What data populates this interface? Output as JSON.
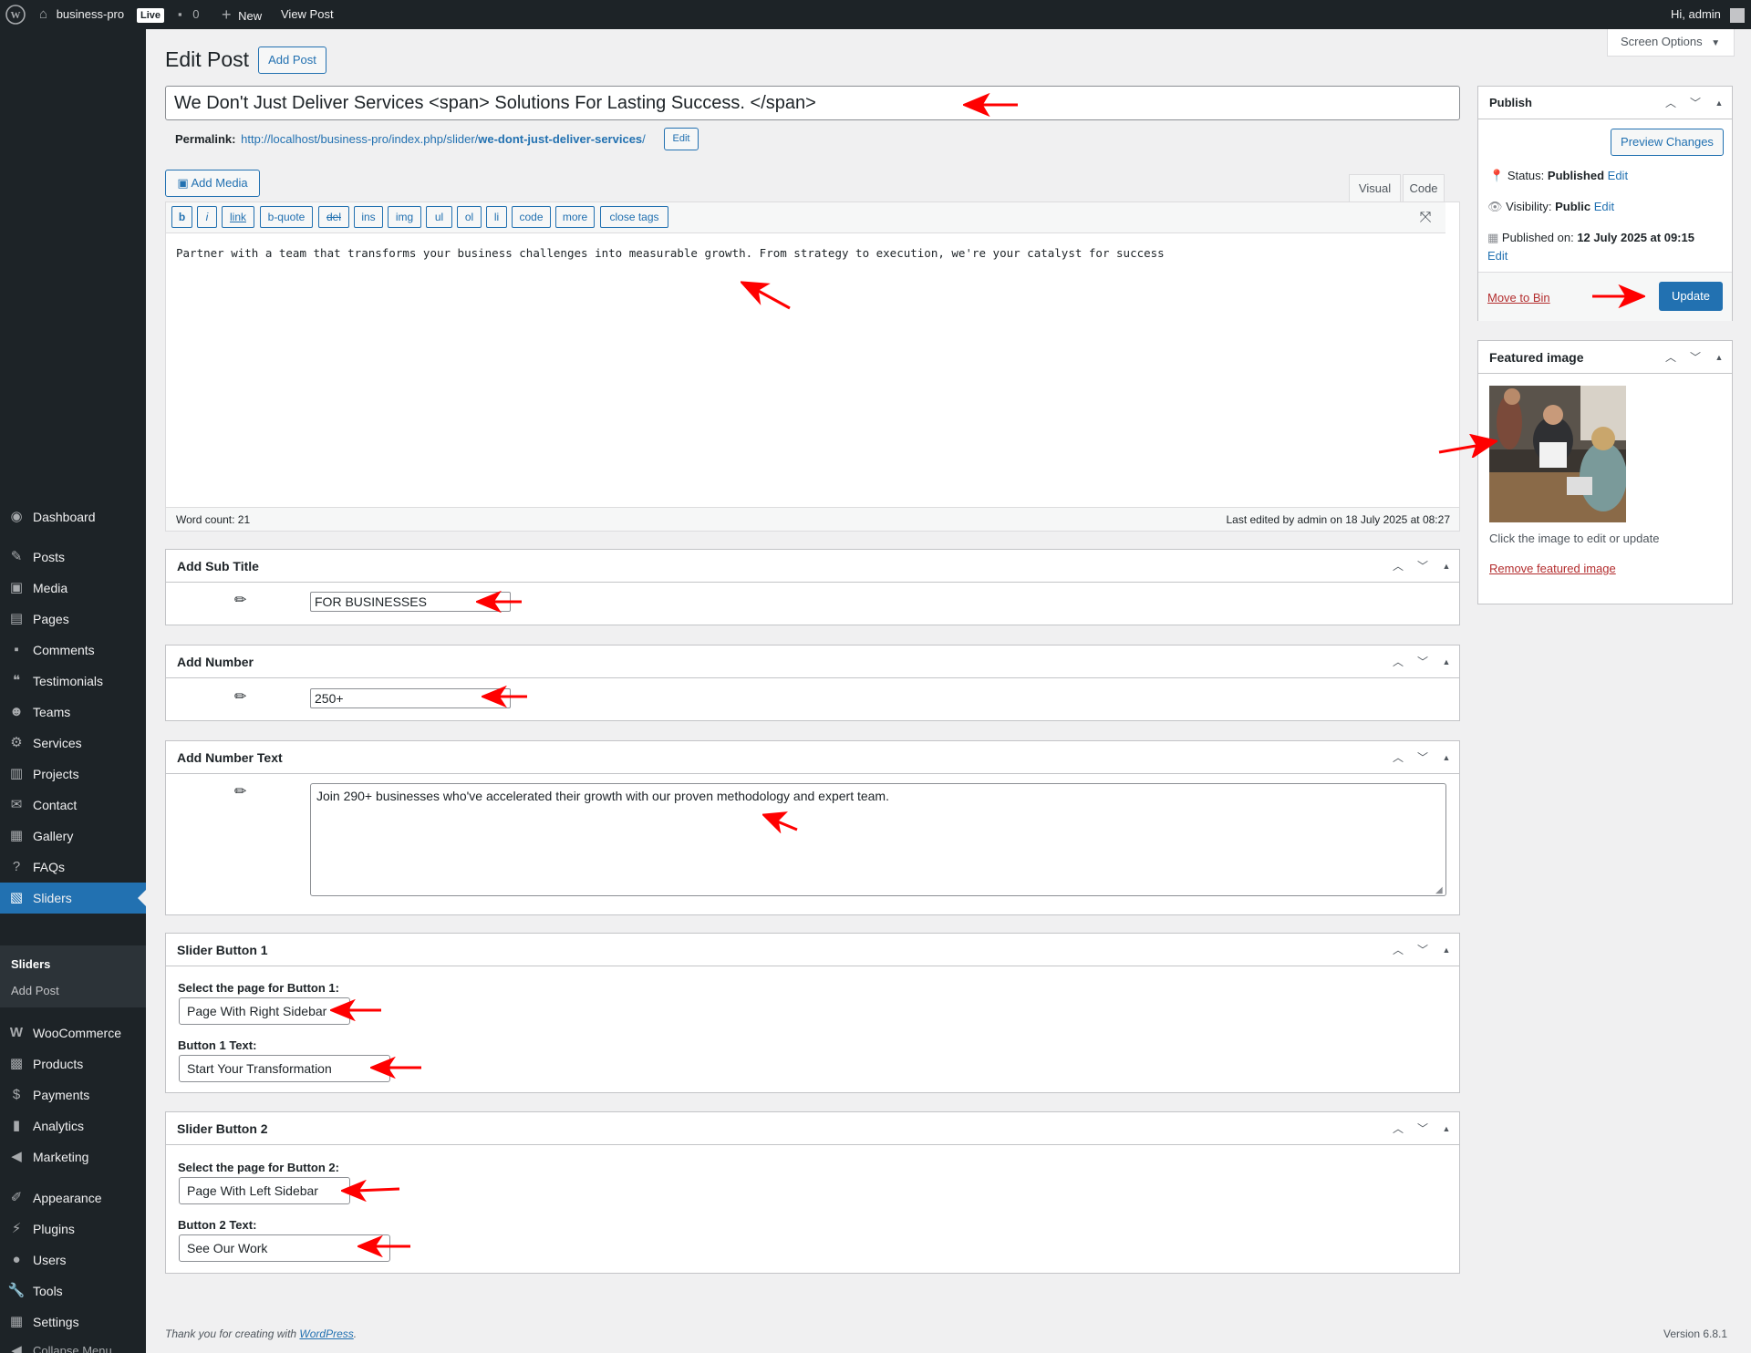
{
  "adminbar": {
    "site_name": "business-pro",
    "live_badge": "Live",
    "comments_count": "0",
    "new_label": "New",
    "view_post_label": "View Post",
    "greeting": "Hi, admin"
  },
  "sidebar": {
    "items": [
      {
        "label": "Dashboard",
        "icon": "dashboard-icon"
      },
      {
        "label": "Posts",
        "icon": "pin-icon"
      },
      {
        "label": "Media",
        "icon": "media-icon"
      },
      {
        "label": "Pages",
        "icon": "pages-icon"
      },
      {
        "label": "Comments",
        "icon": "comments-icon"
      },
      {
        "label": "Testimonials",
        "icon": "testimonials-icon"
      },
      {
        "label": "Teams",
        "icon": "teams-icon"
      },
      {
        "label": "Services",
        "icon": "services-icon"
      },
      {
        "label": "Projects",
        "icon": "projects-icon"
      },
      {
        "label": "Contact",
        "icon": "mail-icon"
      },
      {
        "label": "Gallery",
        "icon": "gallery-icon"
      },
      {
        "label": "FAQs",
        "icon": "faq-icon"
      },
      {
        "label": "Sliders",
        "icon": "sliders-icon"
      },
      {
        "label": "WooCommerce",
        "icon": "woocommerce-icon"
      },
      {
        "label": "Products",
        "icon": "products-icon"
      },
      {
        "label": "Payments",
        "icon": "payments-icon"
      },
      {
        "label": "Analytics",
        "icon": "analytics-icon"
      },
      {
        "label": "Marketing",
        "icon": "marketing-icon"
      },
      {
        "label": "Appearance",
        "icon": "appearance-icon"
      },
      {
        "label": "Plugins",
        "icon": "plugins-icon"
      },
      {
        "label": "Users",
        "icon": "users-icon"
      },
      {
        "label": "Tools",
        "icon": "tools-icon"
      },
      {
        "label": "Settings",
        "icon": "settings-icon"
      }
    ],
    "submenu": [
      "Sliders",
      "Add Post"
    ],
    "collapse_label": "Collapse Menu"
  },
  "header": {
    "title": "Edit Post",
    "add_post_label": "Add Post",
    "screen_options_label": "Screen Options"
  },
  "post": {
    "title": "We Don't Just Deliver Services <span> Solutions For Lasting Success. </span>",
    "permalink_label": "Permalink:",
    "permalink_base": "http://localhost/business-pro/index.php/slider/",
    "permalink_slug": "we-dont-just-deliver-services",
    "permalink_tail": "/",
    "permalink_edit": "Edit"
  },
  "editor": {
    "add_media_label": "Add Media",
    "tab_visual": "Visual",
    "tab_code": "Code",
    "quicktags": [
      "b",
      "i",
      "link",
      "b-quote",
      "del",
      "ins",
      "img",
      "ul",
      "ol",
      "li",
      "code",
      "more",
      "close tags"
    ],
    "content": "Partner with a team that transforms your business challenges into measurable growth. From strategy to execution, we're your catalyst for success",
    "word_count": "Word count: 21",
    "last_edited": "Last edited by admin on 18 July 2025 at 08:27"
  },
  "metaboxes": {
    "subtitle": {
      "title": "Add Sub Title",
      "value": "FOR BUSINESSES"
    },
    "number": {
      "title": "Add Number",
      "value": "250+"
    },
    "number_text": {
      "title": "Add Number Text",
      "value": "Join 290+ businesses who've accelerated their growth with our proven methodology and expert team."
    },
    "button1": {
      "title": "Slider Button 1",
      "select_label": "Select the page for Button 1:",
      "select_value": "Page With Right Sidebar",
      "text_label": "Button 1 Text:",
      "text_value": "Start Your Transformation"
    },
    "button2": {
      "title": "Slider Button 2",
      "select_label": "Select the page for Button 2:",
      "select_value": "Page With Left Sidebar",
      "text_label": "Button 2 Text:",
      "text_value": "See Our Work"
    }
  },
  "publish": {
    "title": "Publish",
    "preview_label": "Preview Changes",
    "status_label": "Status:",
    "status_value": "Published",
    "visibility_label": "Visibility:",
    "visibility_value": "Public",
    "published_label": "Published on:",
    "published_value": "12 July 2025 at 09:15",
    "edit_label": "Edit",
    "move_to_bin": "Move to Bin",
    "update_label": "Update"
  },
  "featured": {
    "title": "Featured image",
    "hint": "Click the image to edit or update",
    "remove_label": "Remove featured image"
  },
  "footer": {
    "thanks_prefix": "Thank you for creating with ",
    "wordpress_link": "WordPress",
    "thanks_suffix": ".",
    "version": "Version 6.8.1"
  },
  "colors": {
    "accent": "#2271b1",
    "sidebar_bg": "#1d2327",
    "danger": "#b32d2e",
    "annotation_arrow": "#ff0000"
  }
}
